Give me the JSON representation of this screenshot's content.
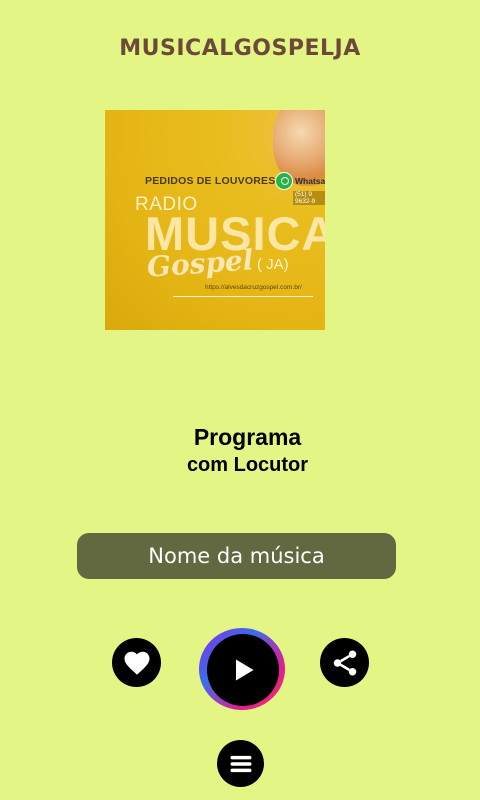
{
  "header": {
    "title": "MUSICALGOSPELJA"
  },
  "cover": {
    "pedidos": "PEDIDOS DE LOUVORES",
    "whatsapp": "Whatsa",
    "phone": "(51) 9 9632-9",
    "radio": "RADIO",
    "musica": "MUSICA",
    "gospel": "Gospel",
    "ja": "( JA)",
    "url": "https://alvesdacruzgospel.com.br/"
  },
  "program": {
    "line1": "Programa",
    "line2": "com Locutor"
  },
  "player": {
    "song_name": "Nome da música"
  },
  "icons": {
    "like": "heart-icon",
    "play": "play-icon",
    "share": "share-icon",
    "menu": "menu-icon"
  },
  "colors": {
    "background": "#e3f585",
    "title": "#6b4a3a",
    "song_bar": "#626940",
    "buttons": "#000000"
  }
}
